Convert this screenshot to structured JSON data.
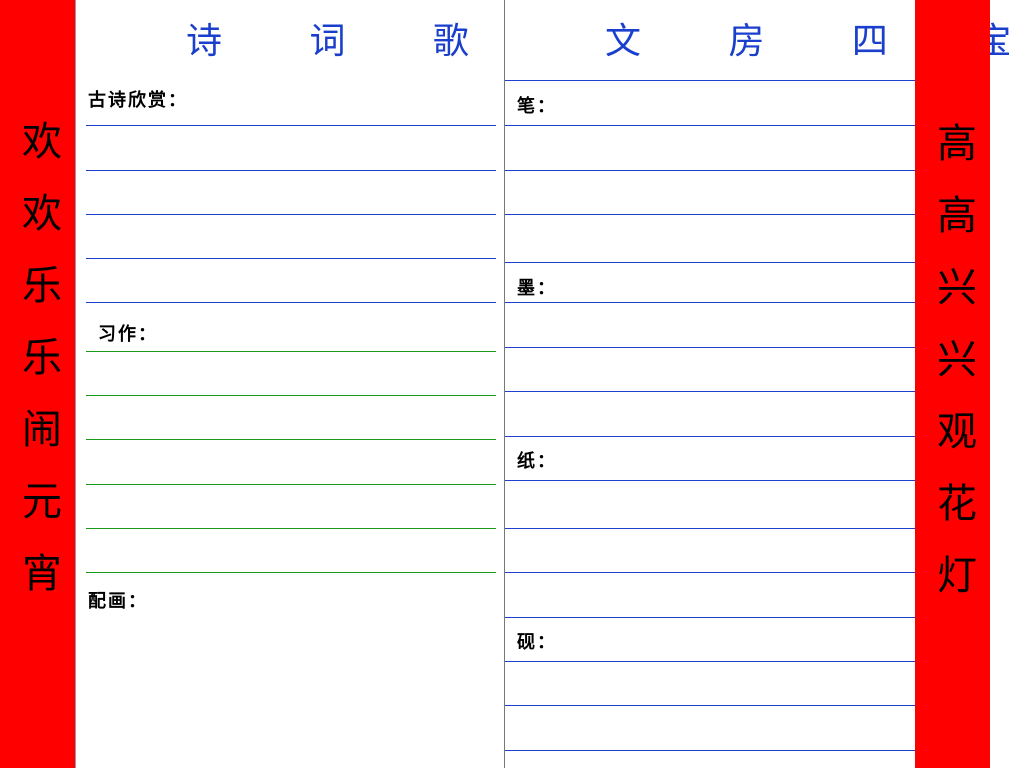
{
  "left_banner": {
    "text": "欢欢乐乐闹元宵"
  },
  "right_banner": {
    "text": "高高兴兴观花灯"
  },
  "poetry_panel": {
    "title": "诗 词 歌 赋",
    "appreciation_label": "古诗欣赏：",
    "practice_label": "习作：",
    "illustration_label": "配画："
  },
  "stationery_panel": {
    "title": "文 房 四 宝",
    "brush_label": "笔：",
    "ink_label": "墨：",
    "paper_label": "纸：",
    "inkstone_label": "砚："
  },
  "colors": {
    "banner": "#ff0000",
    "title_text": "#1a3fcc",
    "rule_blue": "#1f3fd0",
    "rule_green": "#1a9a1a"
  }
}
